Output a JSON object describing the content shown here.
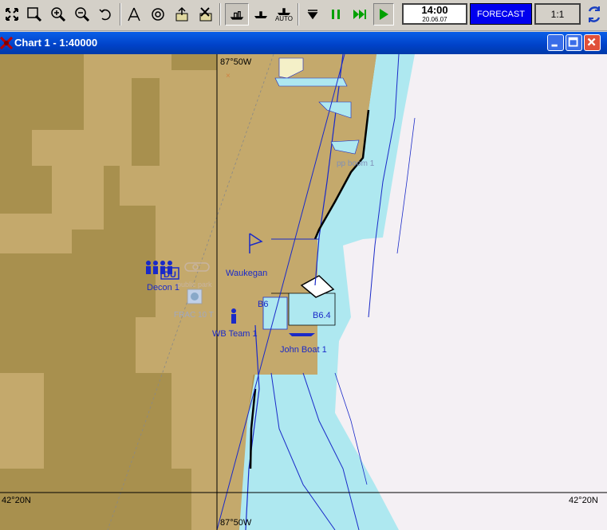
{
  "toolbar": {
    "buttons": [
      {
        "name": "fit-icon"
      },
      {
        "name": "select-zoom-icon"
      },
      {
        "name": "zoom-in-icon"
      },
      {
        "name": "zoom-out-icon"
      },
      {
        "name": "undo-icon"
      },
      {
        "name": "compass-icon"
      },
      {
        "name": "target-icon"
      },
      {
        "name": "export-icon"
      },
      {
        "name": "delete-icon"
      },
      {
        "name": "ship-view-icon"
      },
      {
        "name": "ship-icon"
      },
      {
        "name": "auto-ship-icon"
      },
      {
        "name": "stop-icon"
      },
      {
        "name": "pause-icon"
      },
      {
        "name": "fast-forward-icon"
      },
      {
        "name": "play-icon"
      }
    ],
    "auto_label": "AUTO",
    "clock_time": "14:00",
    "clock_date": "20.06.07",
    "forecast_label": "FORECAST",
    "scale_label": "1:1"
  },
  "window": {
    "title": "Chart 1 - 1:40000"
  },
  "map": {
    "coord_top": "87°50W",
    "coord_bottom": "87°50W",
    "coord_left": "42°20N",
    "coord_right": "42°20N",
    "labels": {
      "boom": "pp boom 1",
      "waukegan": "Waukegan",
      "decon": "Decon 1",
      "du": "DU",
      "public_park": "public park",
      "frac": "FRAC 10 T",
      "b6": "B6",
      "b64": "B6.4",
      "wb_team": "WB Team 1",
      "john_boat": "John Boat 1"
    },
    "colors": {
      "land": "#c4a96c",
      "dark_land": "#a8904e",
      "shallow_water": "#aee8f0",
      "deep_water": "#f4f0f4",
      "contour": "#1a2ac8",
      "grid": "#000000"
    }
  }
}
